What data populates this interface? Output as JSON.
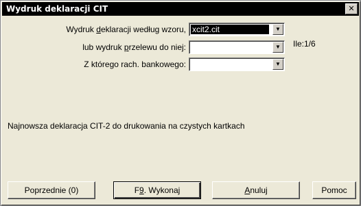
{
  "window": {
    "title": "Wydruk deklaracji CIT",
    "close_glyph": "✕"
  },
  "form": {
    "template_label_pre": "Wydruk ",
    "template_label_key": "d",
    "template_label_post": "eklaracji według wzoru,",
    "template_value": "xcit2.cit",
    "transfer_label_pre": "lub wydruk ",
    "transfer_label_key": "p",
    "transfer_label_post": "rzelewu do niej:",
    "transfer_value": "",
    "account_label": "Z którego rach. bankowego:",
    "account_value": "",
    "counter": "Ile:1/6"
  },
  "info_text": "Najnowsza deklaracja CIT-2 do drukowania na czystych kartkach",
  "buttons": {
    "previous": "Poprzednie (0)",
    "execute_pre": "F",
    "execute_key": "9",
    "execute_post": ". Wykonaj",
    "cancel_key": "A",
    "cancel_post": "nuluj",
    "help": "Pomoc"
  },
  "icons": {
    "dropdown_arrow": "▼"
  }
}
